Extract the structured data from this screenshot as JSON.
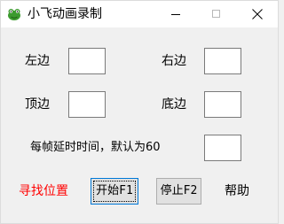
{
  "window": {
    "title": "小飞动画录制",
    "icon": "frog-icon"
  },
  "titlebar_controls": {
    "minimize_icon": "minimize-icon",
    "maximize_icon": "maximize-icon",
    "close_icon": "close-icon"
  },
  "form": {
    "left_label": "左边",
    "left_value": "",
    "right_label": "右边",
    "right_value": "",
    "top_label": "顶边",
    "top_value": "",
    "bottom_label": "底边",
    "bottom_value": "",
    "delay_label": "每帧延时时间，默认为60",
    "delay_value": ""
  },
  "actions": {
    "find_position": "寻找位置",
    "find_position_color": "#ff0000",
    "start_button": "开始F1",
    "stop_button": "停止F2",
    "help": "帮助"
  },
  "colors": {
    "focus_border": "#0078d7",
    "window_bg": "#f0f0f0"
  }
}
